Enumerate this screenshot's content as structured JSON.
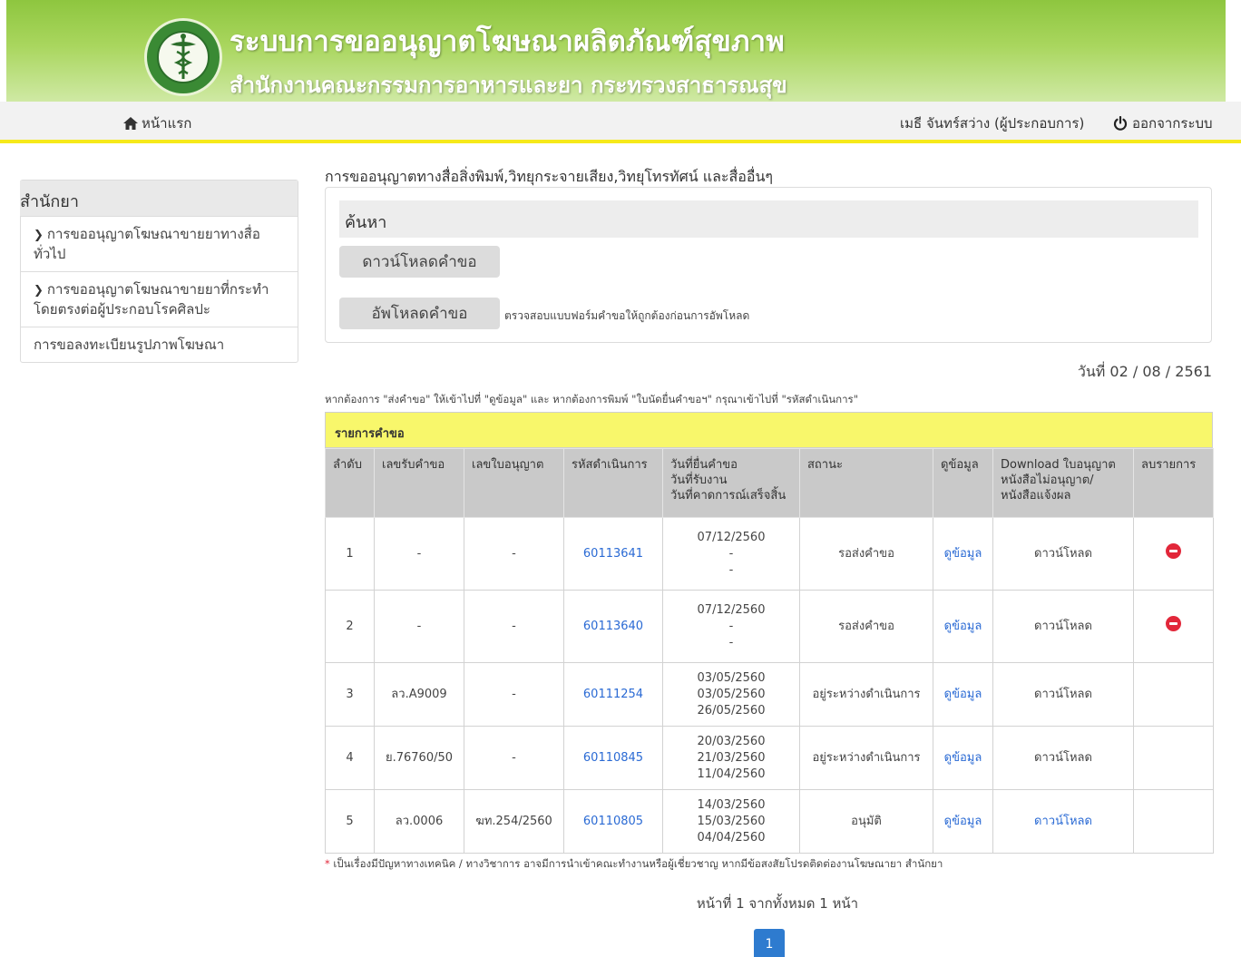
{
  "header": {
    "title": "ระบบการขออนุญาตโฆษณาผลิตภัณฑ์สุขภาพ",
    "subtitle": "สำนักงานคณะกรรมการอาหารและยา กระทรวงสาธารณสุข"
  },
  "navbar": {
    "home_label": "หน้าแรก",
    "user_label": "เมธี จันทร์สว่าง (ผู้ประกอบการ)",
    "logout_label": "ออกจากระบบ"
  },
  "sidebar": {
    "heading": "สำนักยา",
    "items": [
      {
        "label": "การขออนุญาตโฆษณาขายยาทางสื่อทั่วไป"
      },
      {
        "label": "การขออนุญาตโฆษณาขายยาที่กระทำโดยตรงต่อผู้ประกอบโรคศิลปะ"
      },
      {
        "label": "การขอลงทะเบียนรูปภาพโฆษณา"
      }
    ]
  },
  "main": {
    "heading": "การขออนุญาตทางสื่อสิ่งพิมพ์,วิทยุกระจายเสียง,วิทยุโทรทัศน์ และสื่ออื่นๆ",
    "search_title": "ค้นหา",
    "download_button": "ดาวน์โหลดคำขอ",
    "upload_button": "อัพโหลดคำขอ",
    "upload_note": "ตรวจสอบแบบฟอร์มคำขอให้ถูกต้องก่อนการอัพโหลด",
    "date": "วันที่ 02 / 08 / 2561",
    "instruction": "หากต้องการ \"ส่งคำขอ\" ให้เข้าไปที่ \"ดูข้อมูล\" และ หากต้องการพิมพ์ \"ใบนัดยื่นคำขอฯ\" กรุณาเข้าไปที่ \"รหัสดำเนินการ\""
  },
  "table": {
    "title": "รายการคำขอ",
    "headers": {
      "no": "ลำดับ",
      "receipt": "เลขรับคำขอ",
      "license": "เลขใบอนุญาต",
      "code": "รหัสดำเนินการ",
      "dates_1": "วันที่ยื่นคำขอ",
      "dates_2": "วันที่รับงาน",
      "dates_3": "วันที่คาดการณ์เสร็จสิ้น",
      "status": "สถานะ",
      "view": "ดูข้อมูล",
      "dl_1": "Download ใบอนุญาต",
      "dl_2": "หนังสือไม่อนุญาต/",
      "dl_3": "หนังสือแจ้งผล",
      "delete": "ลบรายการ"
    },
    "rows": [
      {
        "no": "1",
        "receipt": "-",
        "license": "-",
        "code": "60113641",
        "d1": "07/12/2560",
        "d2": "-",
        "d3": "-",
        "status": "รอส่งคำขอ",
        "view": "ดูข้อมูล",
        "download": "ดาวน์โหลด"
      },
      {
        "no": "2",
        "receipt": "-",
        "license": "-",
        "code": "60113640",
        "d1": "07/12/2560",
        "d2": "-",
        "d3": "-",
        "status": "รอส่งคำขอ",
        "view": "ดูข้อมูล",
        "download": "ดาวน์โหลด"
      },
      {
        "no": "3",
        "receipt": "ลว.A9009",
        "license": "-",
        "code": "60111254",
        "d1": "03/05/2560",
        "d2": "03/05/2560",
        "d3": "26/05/2560",
        "status": "อยู่ระหว่างดำเนินการ",
        "view": "ดูข้อมูล",
        "download": "ดาวน์โหลด"
      },
      {
        "no": "4",
        "receipt": "ย.76760/50",
        "license": "-",
        "code": "60110845",
        "d1": "20/03/2560",
        "d2": "21/03/2560",
        "d3": "11/04/2560",
        "status": "อยู่ระหว่างดำเนินการ",
        "view": "ดูข้อมูล",
        "download": "ดาวน์โหลด"
      },
      {
        "no": "5",
        "receipt": "ลว.0006",
        "license": "ฆท.254/2560",
        "code": "60110805",
        "d1": "14/03/2560",
        "d2": "15/03/2560",
        "d3": "04/04/2560",
        "status": "อนุมัติ",
        "view": "ดูข้อมูล",
        "download": "ดาวน์โหลด"
      }
    ]
  },
  "footer": {
    "star": "*",
    "note": "เป็นเรื่องมีปัญหาทางเทคนิค / ทางวิชาการ อาจมีการนำเข้าคณะทำงานหรือผู้เชี่ยวชาญ หากมีข้อสงสัยโปรดติดต่องานโฆษณายา สำนักยา",
    "pager_text": "หน้าที่ 1 จากทั้งหมด 1 หน้า",
    "current_page": "1"
  },
  "colors": {
    "banner_green": "#8ec63f",
    "navbar_underline": "#f6e91b",
    "table_title_bg": "#f8f76b",
    "link_blue": "#2a6ad4",
    "delete_red": "#e2273a",
    "pager_blue": "#2e7bcf"
  },
  "icons": [
    "fda-logo-icon",
    "home-icon",
    "power-icon",
    "chevron-right-icon",
    "delete-icon"
  ]
}
